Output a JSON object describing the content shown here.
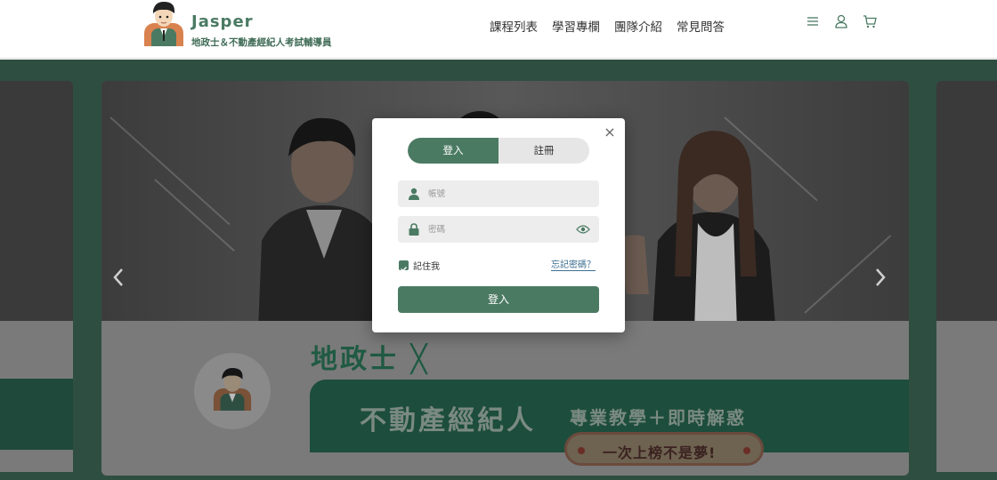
{
  "header": {
    "brand_title": "Jasper",
    "brand_subtitle": "地政士＆不動產經紀人考試輔導員",
    "nav": [
      {
        "label": "課程列表"
      },
      {
        "label": "學習專欄"
      },
      {
        "label": "團隊介紹"
      },
      {
        "label": "常見問答"
      }
    ],
    "icons": [
      "menu-icon",
      "user-icon",
      "cart-icon"
    ]
  },
  "hero": {
    "line1": "地政士 ╳",
    "line2": "不動產經紀人",
    "line3": "專業教學＋即時解惑",
    "pill_text": "一次上榜不是夢!",
    "prev_icon": "chevron-left-icon",
    "next_icon": "chevron-right-icon"
  },
  "modal": {
    "close_label": "×",
    "tabs": [
      {
        "label": "登入",
        "active": true
      },
      {
        "label": "註冊",
        "active": false
      }
    ],
    "account_placeholder": "帳號",
    "password_placeholder": "密碼",
    "remember_label": "記住我",
    "remember_checked": true,
    "forgot_label": "忘記密碼？",
    "submit_label": "登入"
  },
  "colors": {
    "brand_green": "#4b7a63",
    "link_blue": "#3c6f91",
    "overlay_dark": "#2f4e42"
  }
}
